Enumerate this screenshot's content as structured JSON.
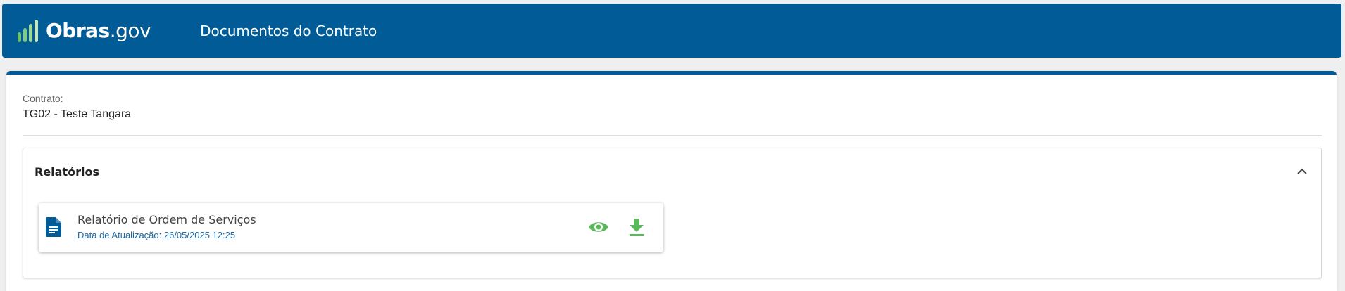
{
  "header": {
    "logo_bold": "Obras",
    "logo_light": ".gov",
    "title": "Documentos do Contrato"
  },
  "contract": {
    "label": "Contrato:",
    "value": "TG02 - Teste Tangara"
  },
  "reports": {
    "title": "Relatórios",
    "items": [
      {
        "name": "Relatório de Ordem de Serviços",
        "date": "Data de Atualização: 26/05/2025 12:25"
      }
    ]
  },
  "colors": {
    "primary": "#005b96",
    "action_green": "#5cb85c",
    "date_blue": "#1a6aa8"
  },
  "icons": {
    "document": "document-icon",
    "view": "eye-icon",
    "download": "download-icon",
    "collapse": "chevron-up-icon"
  }
}
